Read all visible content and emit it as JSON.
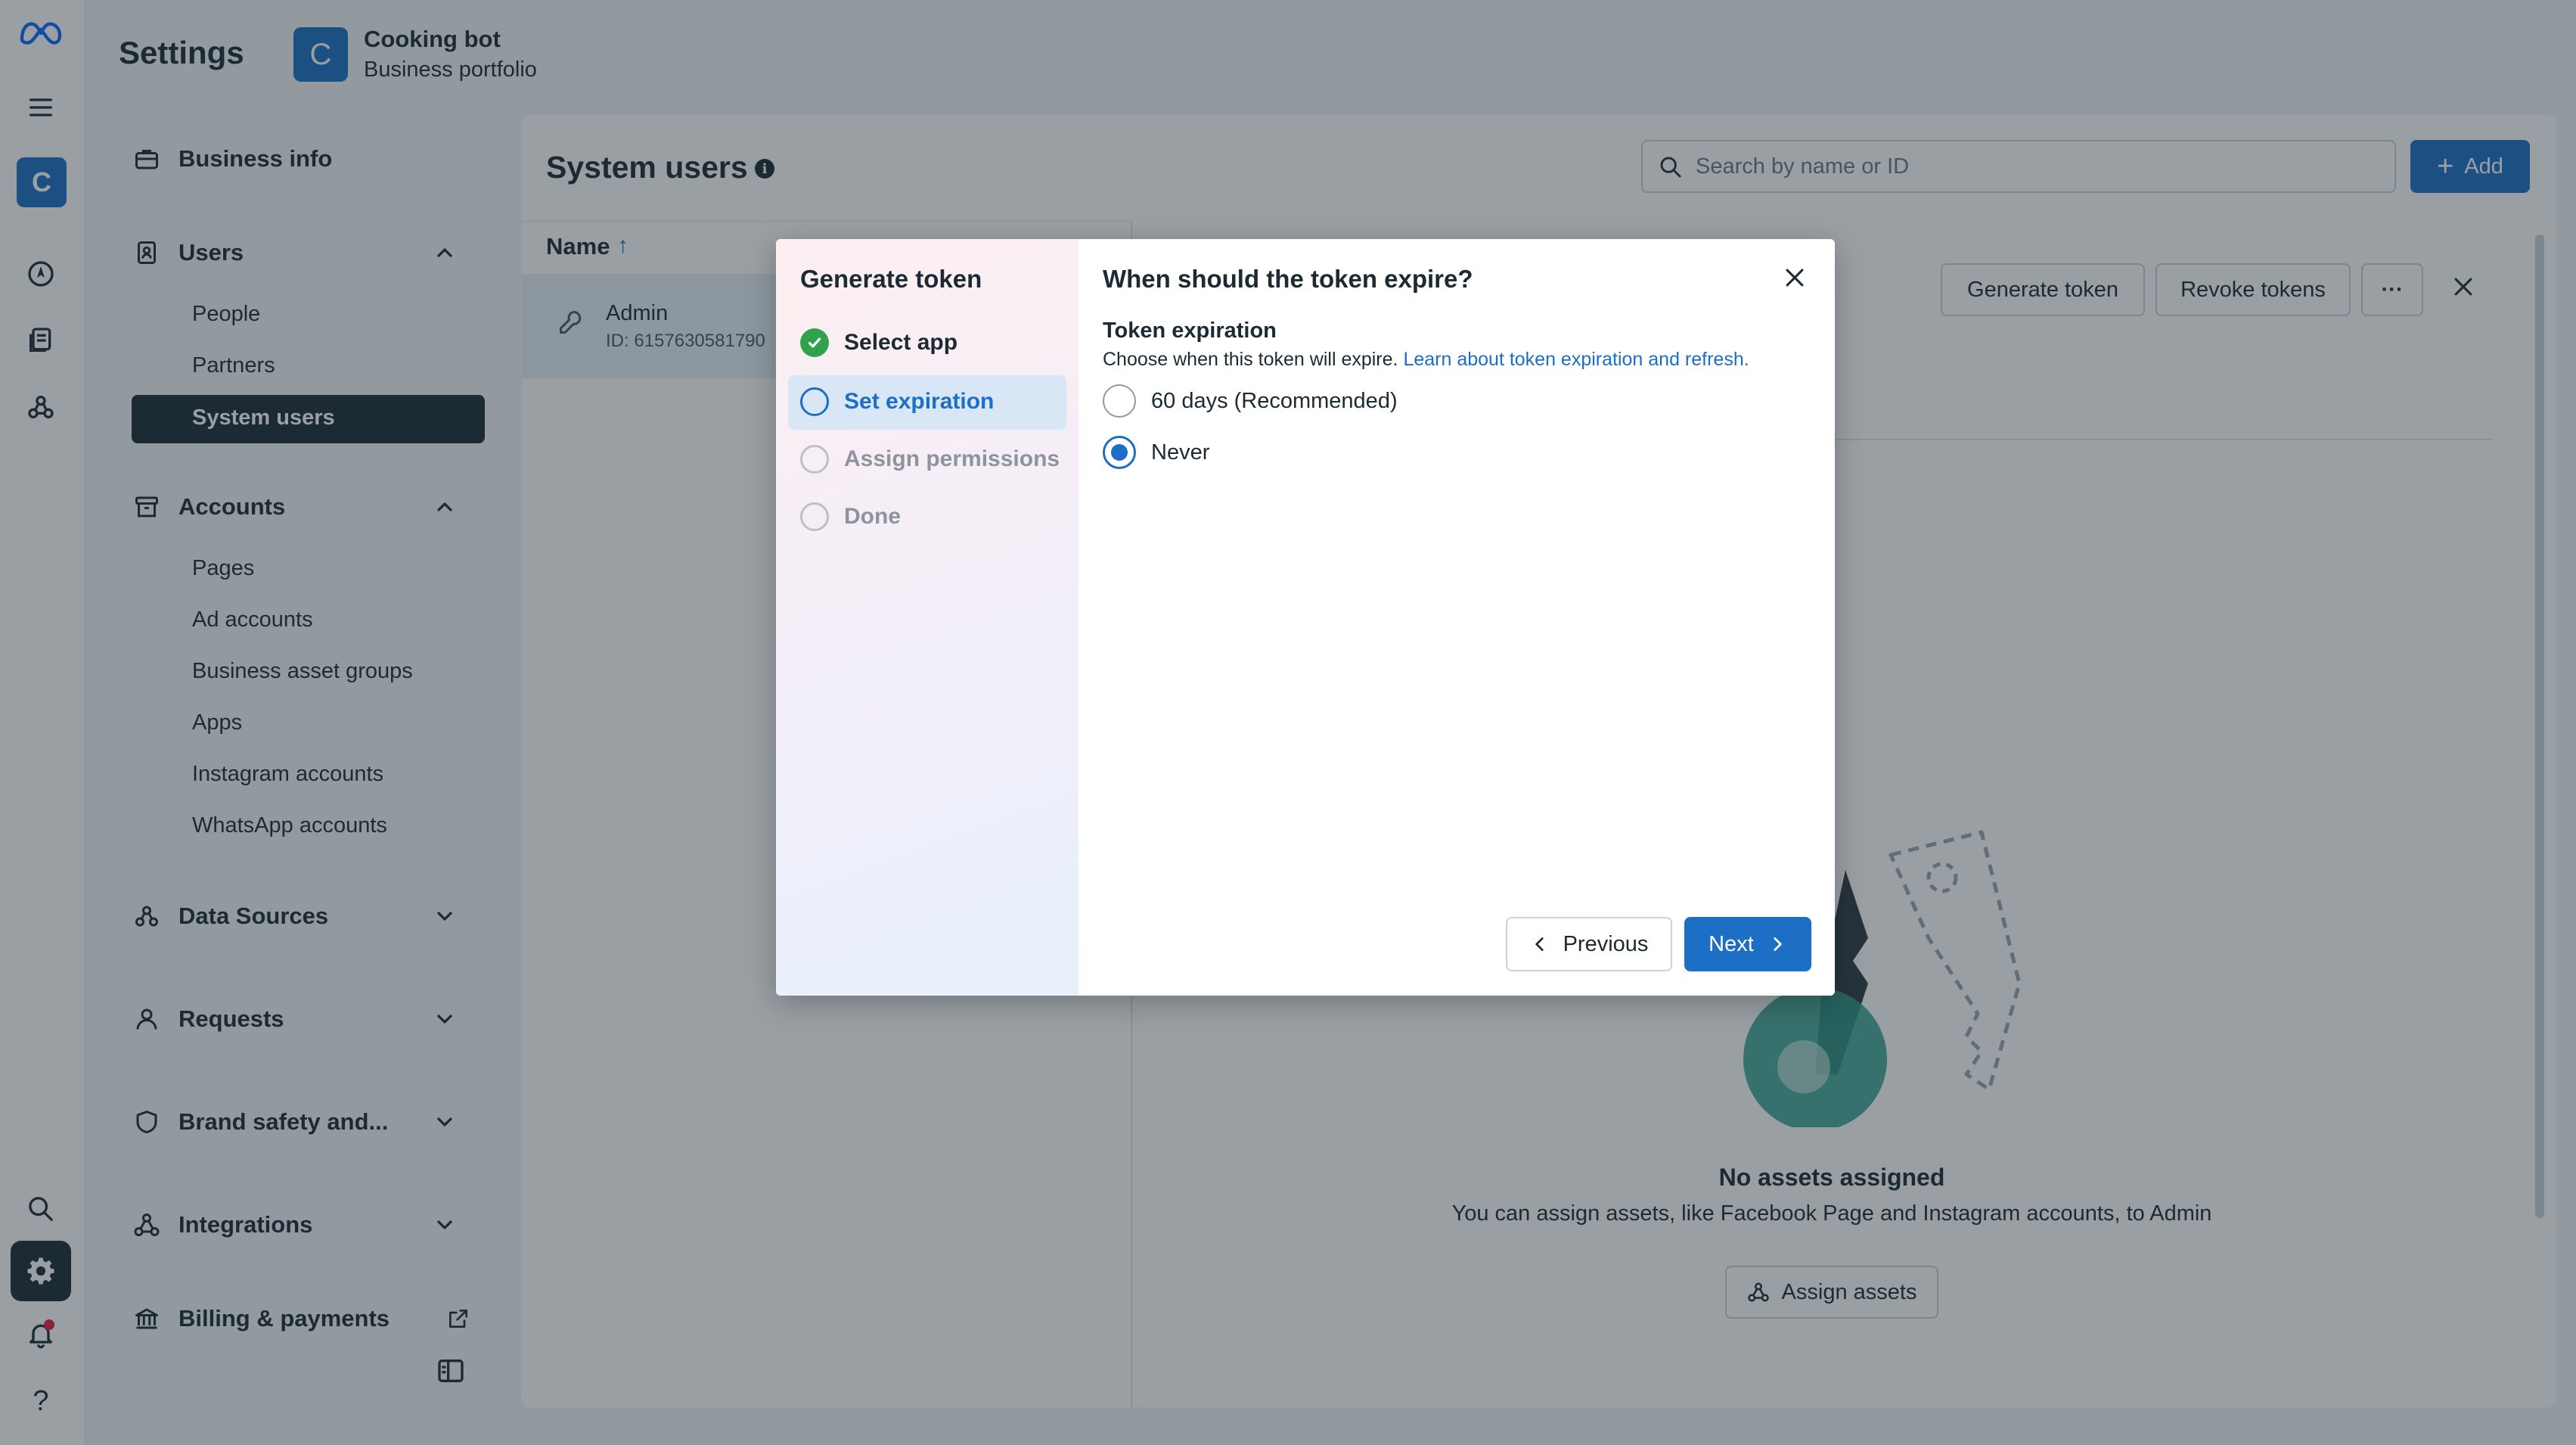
{
  "header": {
    "settings_title": "Settings",
    "portfolio_initial": "C",
    "portfolio_name": "Cooking bot",
    "portfolio_subtitle": "Business portfolio"
  },
  "rail": {
    "avatar_initial": "C",
    "icons": [
      "meta-logo-icon",
      "menu-icon",
      "compass-icon",
      "pages-icon",
      "network-icon",
      "search-icon",
      "gear-icon",
      "bell-icon",
      "help-icon"
    ]
  },
  "nav": {
    "business_info": "Business info",
    "users": {
      "label": "Users",
      "items": [
        "People",
        "Partners",
        "System users"
      ]
    },
    "accounts": {
      "label": "Accounts",
      "items": [
        "Pages",
        "Ad accounts",
        "Business asset groups",
        "Apps",
        "Instagram accounts",
        "WhatsApp accounts"
      ]
    },
    "data_sources": "Data Sources",
    "requests": "Requests",
    "brand_safety": "Brand safety and...",
    "integrations": "Integrations",
    "billing": "Billing & payments"
  },
  "main": {
    "title": "System users",
    "search_placeholder": "Search by name or ID",
    "add_label": "Add",
    "column_name": "Name",
    "row": {
      "name": "Admin",
      "id": "ID: 6157630581790"
    },
    "generate_token": "Generate token",
    "revoke_tokens": "Revoke tokens",
    "more": "···",
    "empty_title": "No assets assigned",
    "empty_subtitle": "You can assign assets, like Facebook Page and Instagram accounts, to Admin",
    "assign_assets": "Assign assets"
  },
  "modal": {
    "sidebar_title": "Generate token",
    "steps": [
      {
        "label": "Select app",
        "state": "done"
      },
      {
        "label": "Set expiration",
        "state": "active"
      },
      {
        "label": "Assign permissions",
        "state": "pending"
      },
      {
        "label": "Done",
        "state": "pending"
      }
    ],
    "title": "When should the token expire?",
    "field_label": "Token expiration",
    "help_text": "Choose when this token will expire.",
    "help_link": "Learn about token expiration and refresh.",
    "options": [
      {
        "label": "60 days (Recommended)",
        "selected": false
      },
      {
        "label": "Never",
        "selected": true
      }
    ],
    "previous_label": "Previous",
    "next_label": "Next"
  },
  "colors": {
    "accent": "#1c6fc4",
    "dark": "#1c2b33",
    "success": "#31a24c"
  }
}
